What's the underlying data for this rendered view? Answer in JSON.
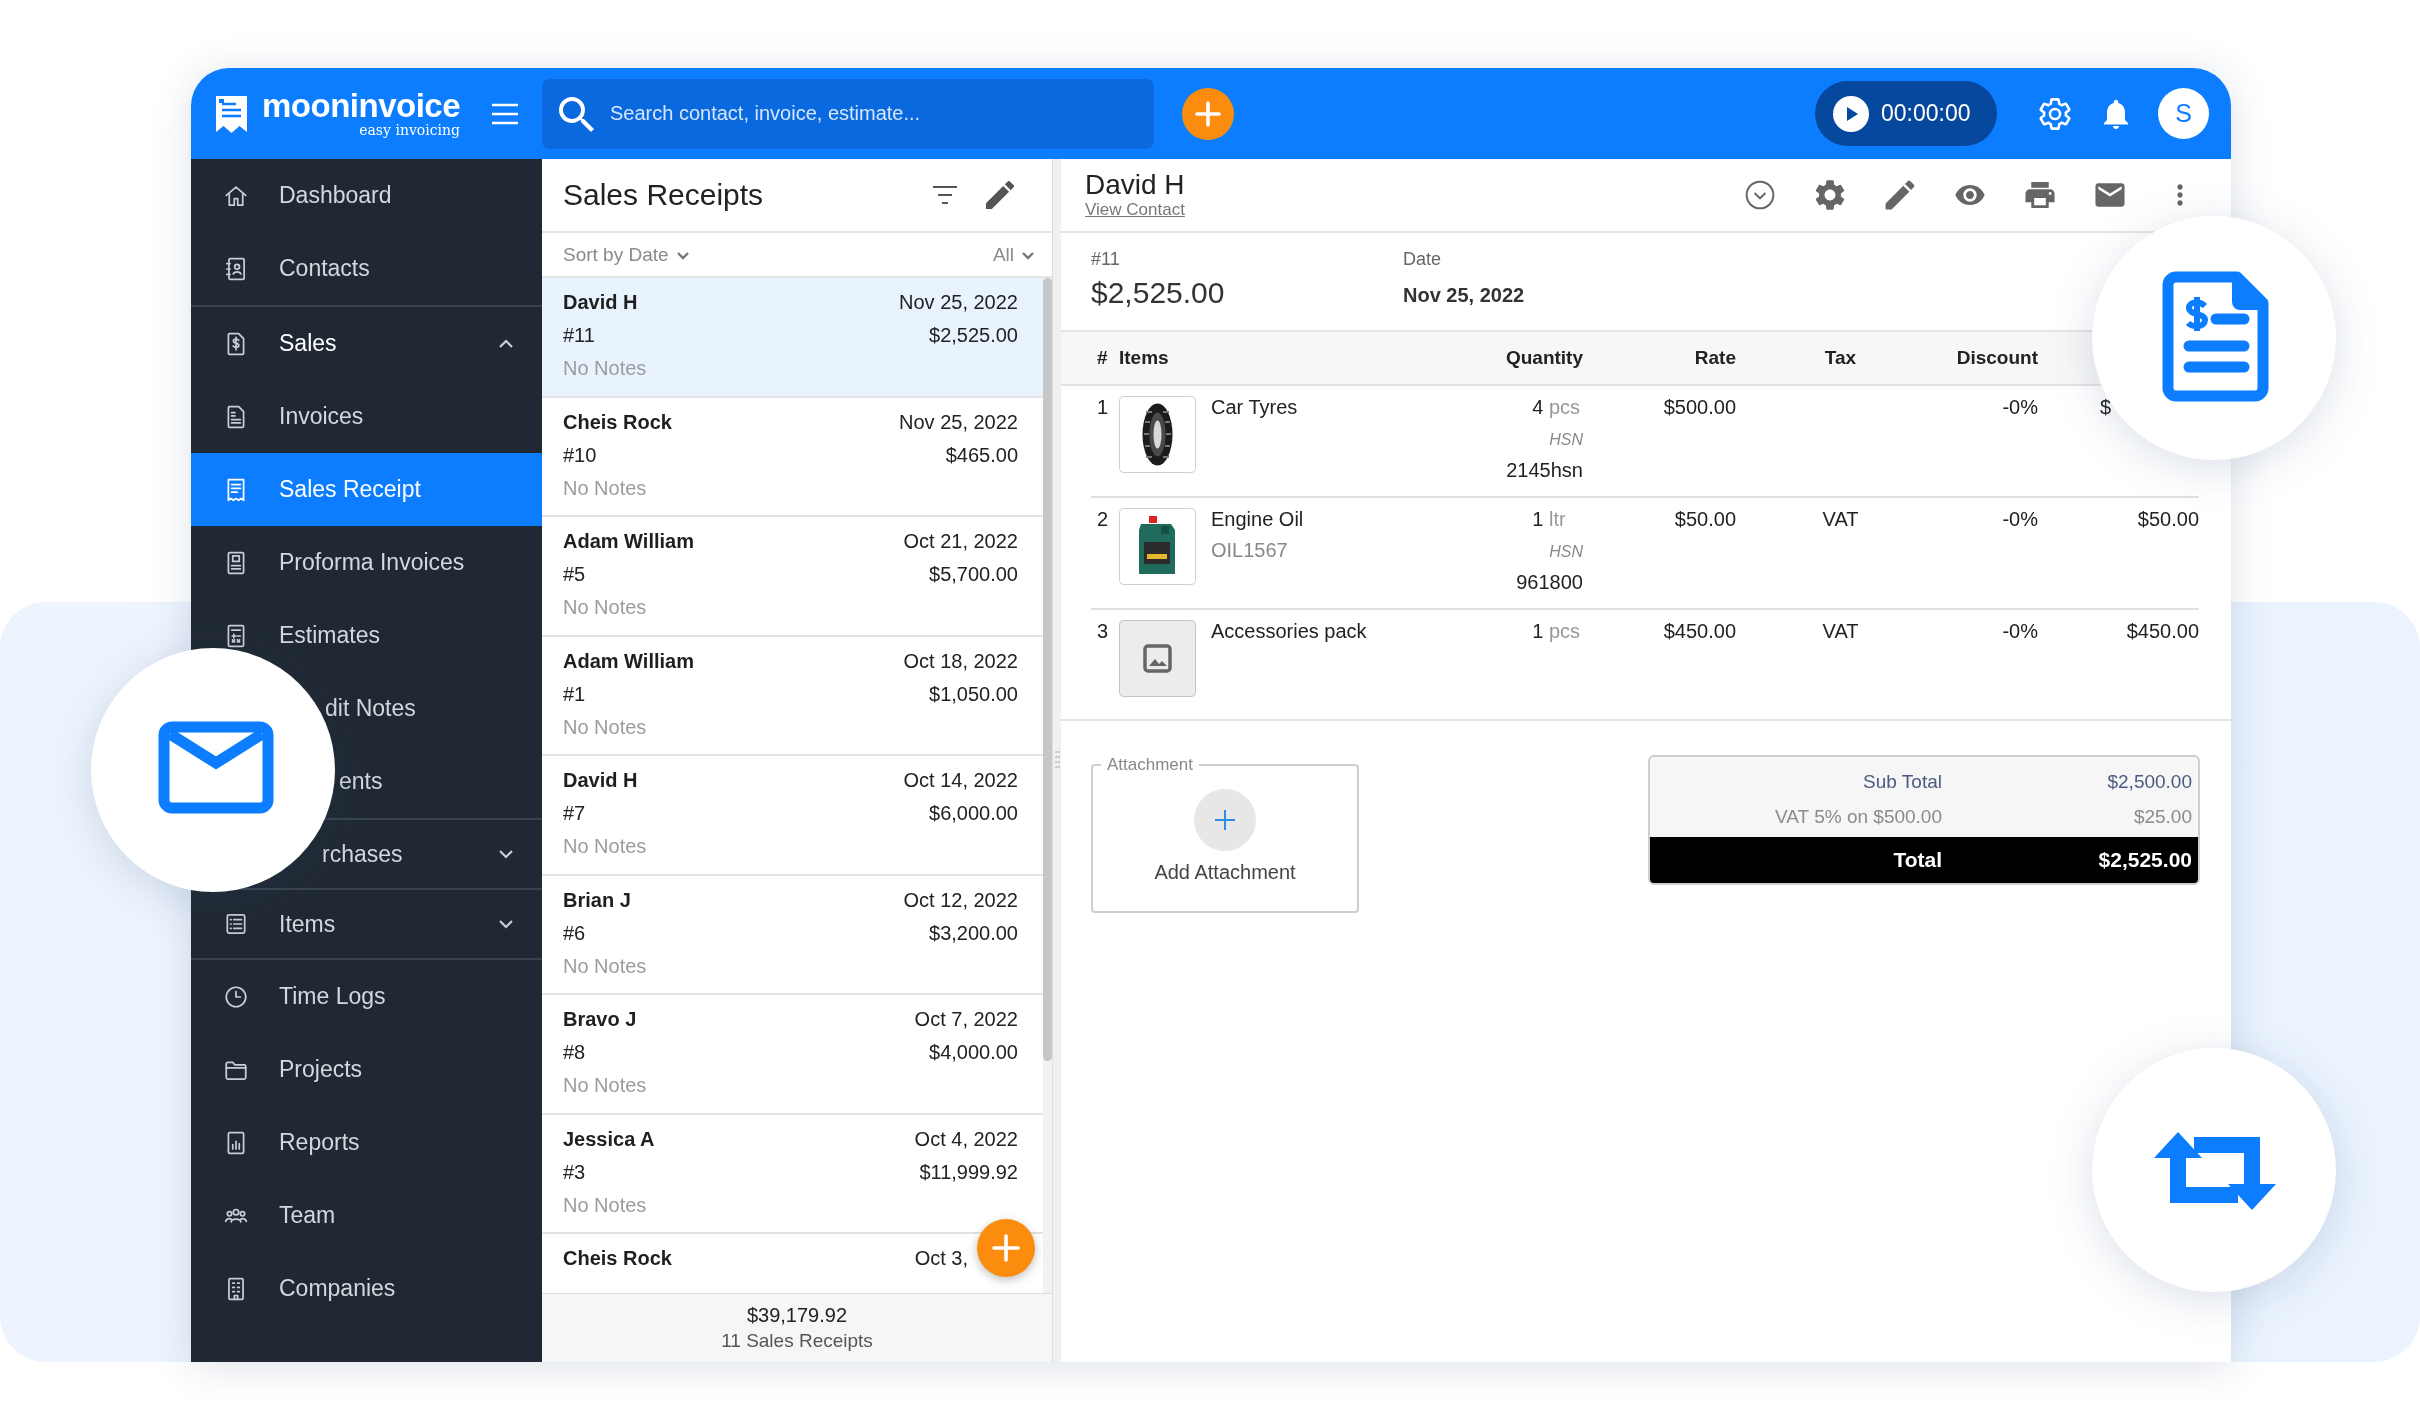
{
  "header": {
    "logo": {
      "name": "mooninvoice",
      "tagline": "easy invoicing"
    },
    "search": {
      "placeholder": "Search contact, invoice, estimate..."
    },
    "timer": "00:00:00",
    "avatar": "S"
  },
  "sidebar": {
    "items": [
      {
        "kind": "link",
        "label": "Dashboard",
        "selected": false
      },
      {
        "kind": "link",
        "label": "Contacts",
        "selected": false
      },
      {
        "kind": "group",
        "label": "Sales",
        "selected": false,
        "expanded": true,
        "children": [
          {
            "kind": "link",
            "label": "Invoices",
            "selected": false
          },
          {
            "kind": "link",
            "label": "Sales Receipt",
            "selected": true
          },
          {
            "kind": "link",
            "label": "Proforma Invoices",
            "selected": false
          },
          {
            "kind": "link",
            "label": "Estimates",
            "selected": false
          },
          {
            "kind": "link",
            "label": "dit Notes",
            "selected": false
          },
          {
            "kind": "link",
            "label": "ents",
            "selected": false
          }
        ]
      },
      {
        "kind": "group",
        "label": "rchases",
        "selected": false,
        "expanded": false
      },
      {
        "kind": "group",
        "label": "Items",
        "selected": false,
        "expanded": false
      },
      {
        "kind": "link",
        "label": "Time Logs",
        "selected": false
      },
      {
        "kind": "link",
        "label": "Projects",
        "selected": false
      },
      {
        "kind": "link",
        "label": "Reports",
        "selected": false
      },
      {
        "kind": "link",
        "label": "Team",
        "selected": false
      },
      {
        "kind": "link",
        "label": "Companies",
        "selected": false
      }
    ]
  },
  "list": {
    "title": "Sales Receipts",
    "sort": "Sort by Date",
    "filter": "All",
    "rows": [
      {
        "name": "David H",
        "date": "Nov 25, 2022",
        "number": "#11",
        "amount": "$2,525.00",
        "notes": "No Notes",
        "selected": true
      },
      {
        "name": "Cheis Rock",
        "date": "Nov 25, 2022",
        "number": "#10",
        "amount": "$465.00",
        "notes": "No Notes",
        "selected": false
      },
      {
        "name": "Adam William",
        "date": "Oct 21, 2022",
        "number": "#5",
        "amount": "$5,700.00",
        "notes": "No Notes",
        "selected": false
      },
      {
        "name": "Adam William",
        "date": "Oct 18, 2022",
        "number": "#1",
        "amount": "$1,050.00",
        "notes": "No Notes",
        "selected": false
      },
      {
        "name": "David H",
        "date": "Oct 14, 2022",
        "number": "#7",
        "amount": "$6,000.00",
        "notes": "No Notes",
        "selected": false
      },
      {
        "name": "Brian J",
        "date": "Oct 12, 2022",
        "number": "#6",
        "amount": "$3,200.00",
        "notes": "No Notes",
        "selected": false
      },
      {
        "name": "Bravo J",
        "date": "Oct 7, 2022",
        "number": "#8",
        "amount": "$4,000.00",
        "notes": "No Notes",
        "selected": false
      },
      {
        "name": "Jessica A",
        "date": "Oct 4, 2022",
        "number": "#3",
        "amount": "$11,999.92",
        "notes": "No Notes",
        "selected": false
      },
      {
        "name": "Cheis Rock",
        "date": "Oct 3,",
        "selected": false
      }
    ],
    "total": "$39,179.92",
    "count": "11 Sales Receipts"
  },
  "detail": {
    "customer": "David H",
    "view_contact": "View Contact",
    "number": "#11",
    "amount": "$2,525.00",
    "date_label": "Date",
    "date": "Nov 25, 2022",
    "table": {
      "columns": [
        "#",
        "Items",
        "Quantity",
        "Rate",
        "Tax",
        "Discount"
      ],
      "rows": [
        {
          "index": "1",
          "kind": "photo",
          "name": "Car Tyres",
          "qty": "4",
          "unit": "pcs",
          "hsn_label": "HSN",
          "hsn": "2145hsn",
          "rate": "$500.00",
          "discount": "-0%",
          "amount": "$"
        },
        {
          "index": "2",
          "kind": "photo",
          "name": "Engine Oil",
          "sku": "OIL1567",
          "qty": "1",
          "unit": "ltr",
          "hsn_label": "HSN",
          "hsn": "961800",
          "rate": "$50.00",
          "tax": "VAT",
          "discount": "-0%",
          "amount": "$50.00"
        },
        {
          "index": "3",
          "kind": "placeholder",
          "name": "Accessories pack",
          "qty": "1",
          "unit": "pcs",
          "rate": "$450.00",
          "tax": "VAT",
          "discount": "-0%",
          "amount": "$450.00"
        }
      ]
    },
    "attachment": {
      "legend": "Attachment",
      "button": "Add Attachment"
    },
    "totals": [
      {
        "kind": "subtotal",
        "label": "Sub Total",
        "value": "$2,500.00"
      },
      {
        "kind": "tax",
        "label": "VAT 5% on $500.00",
        "value": "$25.00"
      },
      {
        "kind": "total",
        "label": "Total",
        "value": "$2,525.00"
      }
    ]
  }
}
